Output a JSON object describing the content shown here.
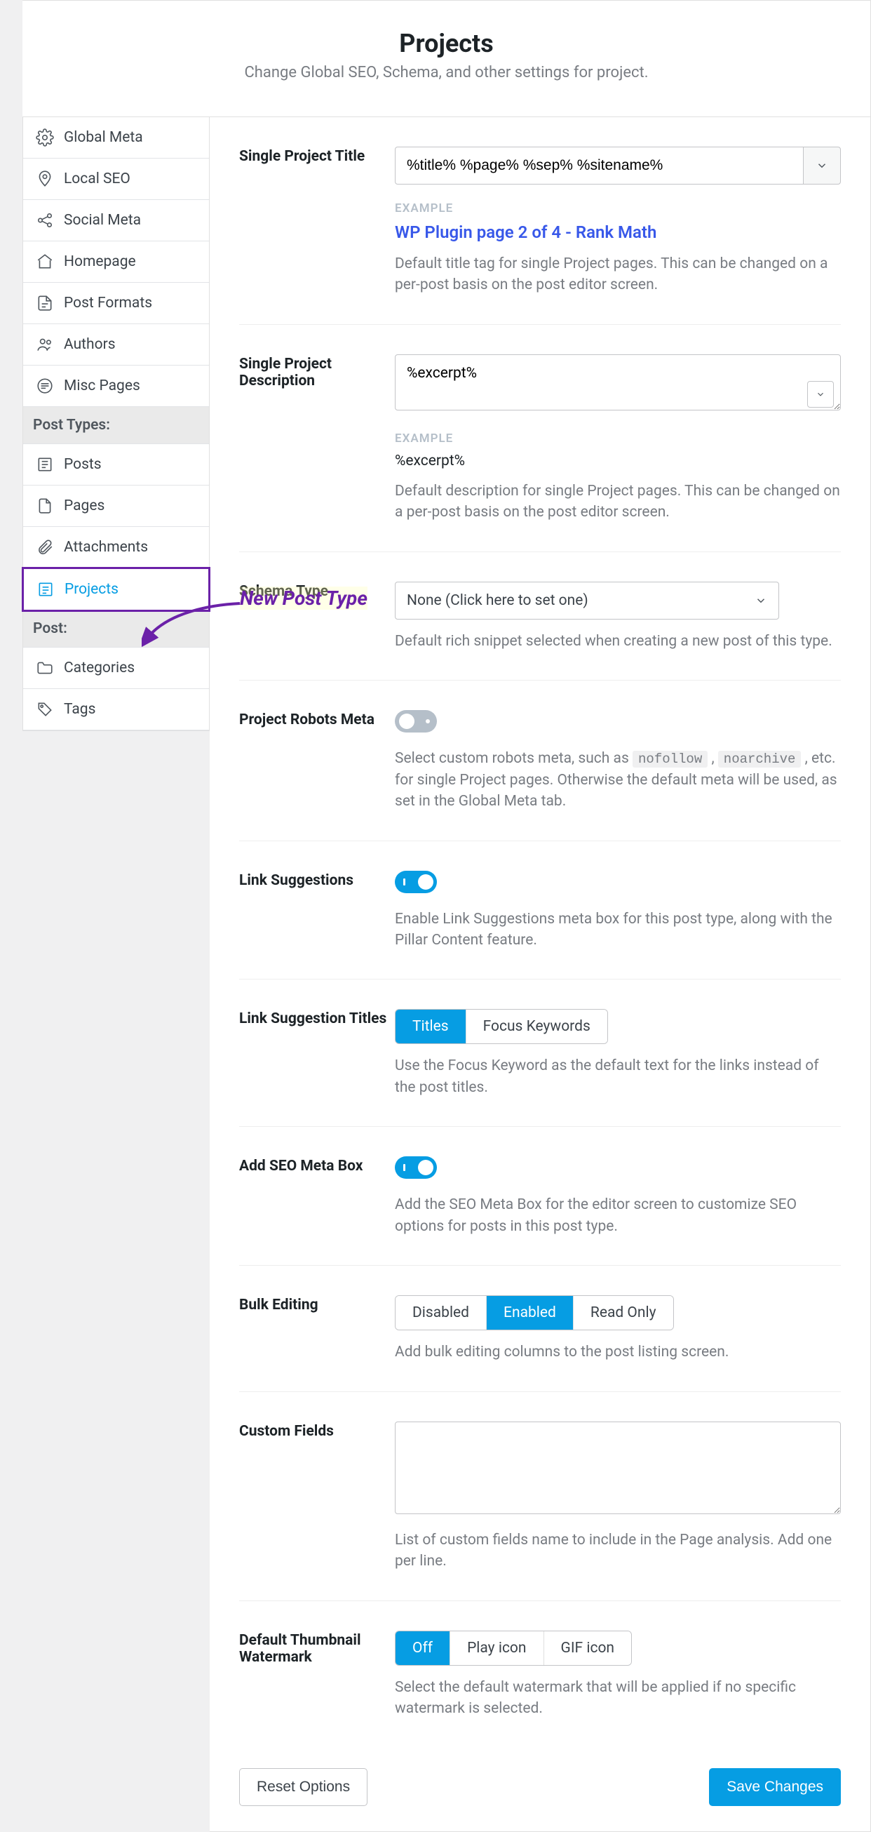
{
  "header": {
    "title": "Projects",
    "subtitle": "Change Global SEO, Schema, and other settings for project."
  },
  "sidebar": {
    "items_top": [
      {
        "label": "Global Meta",
        "icon": "gear-icon"
      },
      {
        "label": "Local SEO",
        "icon": "pin-icon"
      },
      {
        "label": "Social Meta",
        "icon": "share-icon"
      },
      {
        "label": "Homepage",
        "icon": "home-icon"
      },
      {
        "label": "Post Formats",
        "icon": "document-icon"
      },
      {
        "label": "Authors",
        "icon": "users-icon"
      },
      {
        "label": "Misc Pages",
        "icon": "lines-icon"
      }
    ],
    "section1_label": "Post Types:",
    "items_post_types": [
      {
        "label": "Posts",
        "icon": "post-icon"
      },
      {
        "label": "Pages",
        "icon": "page-icon"
      },
      {
        "label": "Attachments",
        "icon": "attachment-icon"
      },
      {
        "label": "Projects",
        "icon": "project-icon",
        "active": true
      }
    ],
    "section2_label": "Post:",
    "items_tax": [
      {
        "label": "Categories",
        "icon": "folder-icon"
      },
      {
        "label": "Tags",
        "icon": "tag-icon"
      }
    ]
  },
  "annotation_label": "New Post Type",
  "settings": {
    "title": {
      "label": "Single Project Title",
      "value": "%title% %page% %sep% %sitename%",
      "example_label": "EXAMPLE",
      "example_value": "WP Plugin page 2 of 4 - Rank Math",
      "help": "Default title tag for single Project pages. This can be changed on a per-post basis on the post editor screen."
    },
    "description": {
      "label": "Single Project Description",
      "value": "%excerpt%",
      "example_label": "EXAMPLE",
      "example_value": "%excerpt%",
      "help": "Default description for single Project pages. This can be changed on a per-post basis on the post editor screen."
    },
    "schema": {
      "label": "Schema Type",
      "selected": "None (Click here to set one)",
      "help": "Default rich snippet selected when creating a new post of this type."
    },
    "robots": {
      "label": "Project Robots Meta",
      "on": false,
      "help_pre": "Select custom robots meta, such as ",
      "code1": "nofollow",
      "sep": " , ",
      "code2": "noarchive",
      "help_post": " , etc. for single Project pages. Otherwise the default meta will be used, as set in the Global Meta tab."
    },
    "link_sugg": {
      "label": "Link Suggestions",
      "on": true,
      "help": "Enable Link Suggestions meta box for this post type, along with the Pillar Content feature."
    },
    "link_titles": {
      "label": "Link Suggestion Titles",
      "options": [
        "Titles",
        "Focus Keywords"
      ],
      "active": 0,
      "help": "Use the Focus Keyword as the default text for the links instead of the post titles."
    },
    "seo_box": {
      "label": "Add SEO Meta Box",
      "on": true,
      "help": "Add the SEO Meta Box for the editor screen to customize SEO options for posts in this post type."
    },
    "bulk_edit": {
      "label": "Bulk Editing",
      "options": [
        "Disabled",
        "Enabled",
        "Read Only"
      ],
      "active": 1,
      "help": "Add bulk editing columns to the post listing screen."
    },
    "custom_fields": {
      "label": "Custom Fields",
      "value": "",
      "help": "List of custom fields name to include in the Page analysis. Add one per line."
    },
    "watermark": {
      "label": "Default Thumbnail Watermark",
      "options": [
        "Off",
        "Play icon",
        "GIF icon"
      ],
      "active": 0,
      "help": "Select the default watermark that will be applied if no specific watermark is selected."
    }
  },
  "footer": {
    "reset": "Reset Options",
    "save": "Save Changes"
  }
}
